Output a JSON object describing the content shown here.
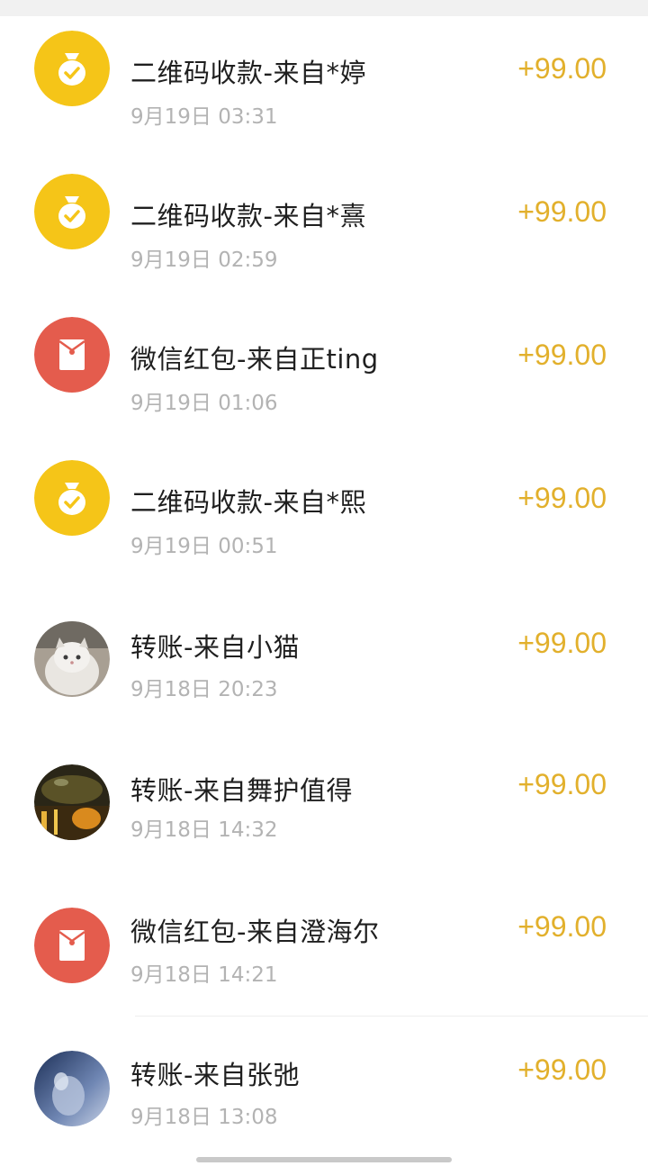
{
  "transactions": [
    {
      "icon": "money-bag-icon",
      "title": "二维码收款-来自*婷",
      "time": "9月19日 03:31",
      "amount": "+99.00"
    },
    {
      "icon": "money-bag-icon",
      "title": "二维码收款-来自*熹",
      "time": "9月19日 02:59",
      "amount": "+99.00"
    },
    {
      "icon": "red-packet-icon",
      "title": "微信红包-来自正ting",
      "time": "9月19日 01:06",
      "amount": "+99.00"
    },
    {
      "icon": "money-bag-icon",
      "title": "二维码收款-来自*熙",
      "time": "9月19日 00:51",
      "amount": "+99.00"
    },
    {
      "icon": "cat-avatar",
      "title": "转账-来自小猫",
      "time": "9月18日 20:23",
      "amount": "+99.00"
    },
    {
      "icon": "night-scene-avatar",
      "title": "转账-来自舞护值得",
      "time": "9月18日 14:32",
      "amount": "+99.00"
    },
    {
      "icon": "red-packet-icon",
      "title": "微信红包-来自澄海尔",
      "time": "9月18日 14:21",
      "amount": "+99.00"
    },
    {
      "icon": "sky-avatar",
      "title": "转账-来自张弛",
      "time": "9月18日 13:08",
      "amount": "+99.00"
    }
  ],
  "colors": {
    "amount": "#e2b02c",
    "money_bag_bg": "#f5c518",
    "red_packet_bg": "#e45c4d",
    "title": "#1f1f1f",
    "time": "#b3b3b3"
  }
}
